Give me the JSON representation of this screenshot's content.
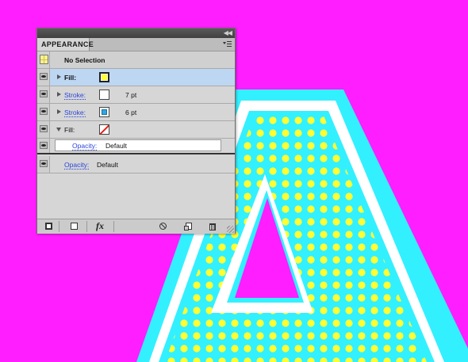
{
  "panel": {
    "tab_label": "APPEARANCE",
    "header_label": "No Selection",
    "rows": [
      {
        "label": "Fill:",
        "swatch": "yellow"
      },
      {
        "label": "Stroke:",
        "swatch": "white",
        "weight": "7 pt"
      },
      {
        "label": "Stroke:",
        "swatch": "cyan",
        "weight": "6 pt"
      },
      {
        "label": "Fill:",
        "swatch": "none"
      }
    ],
    "sub_opacity": {
      "label": "Opacity:",
      "value": "Default"
    },
    "opacity": {
      "label": "Opacity:",
      "value": "Default"
    },
    "bottom_buttons": [
      "add-new-stroke",
      "add-new-fill",
      "add-new-effect",
      "clear-appearance",
      "duplicate-item",
      "delete-item"
    ],
    "fx_label": "fx"
  },
  "colors": {
    "background": "#ff1eff",
    "letter_cyan": "#33f0ff",
    "dot_yellow": "#ffff33",
    "stroke_white": "#ffffff",
    "selection_row": "#bdd6f2",
    "link_blue": "#2a44d8"
  }
}
